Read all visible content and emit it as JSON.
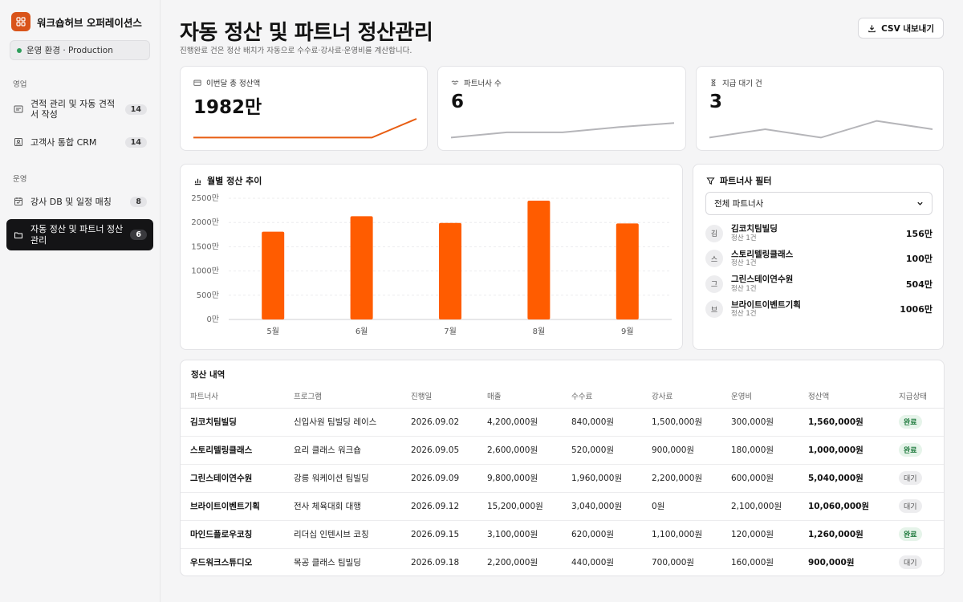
{
  "app": {
    "name": "워크숍허브 오퍼레이션스"
  },
  "env": {
    "label": "운영 환경 · Production"
  },
  "sidebar": {
    "sections": [
      {
        "title": "영업",
        "items": [
          {
            "label": "견적 관리 및 자동 견적서 작성",
            "badge": "14",
            "icon": "quote-icon"
          },
          {
            "label": "고객사 통합 CRM",
            "badge": "14",
            "icon": "contacts-icon"
          }
        ]
      },
      {
        "title": "운영",
        "items": [
          {
            "label": "강사 DB 및 일정 매칭",
            "badge": "8",
            "icon": "calendar-icon"
          },
          {
            "label": "자동 정산 및 파트너 정산관리",
            "badge": "6",
            "icon": "folder-icon",
            "active": true
          }
        ]
      }
    ]
  },
  "header": {
    "title": "자동 정산 및 파트너 정산관리",
    "subtitle": "진행완료 건은 정산 배치가 자동으로 수수료·강사료·운영비를 계산합니다.",
    "csv_label": "CSV 내보내기"
  },
  "kpis": [
    {
      "label": "이번달 총 정산액",
      "value": "1982만",
      "icon": "wallet-icon",
      "spark": [
        0.1,
        0.1,
        0.1,
        0.1,
        0.1,
        1.0
      ],
      "color": "#e85d12"
    },
    {
      "label": "파트너사 수",
      "value": "6",
      "icon": "handshake-icon",
      "spark": [
        0.1,
        0.35,
        0.35,
        0.6,
        0.8
      ],
      "color": "#b5b5b9"
    },
    {
      "label": "지급 대기 건",
      "value": "3",
      "icon": "hourglass-icon",
      "spark": [
        0.1,
        0.5,
        0.1,
        0.9,
        0.5
      ],
      "color": "#b5b5b9"
    }
  ],
  "chart_data": {
    "title": "월별 정산 추이",
    "type": "bar",
    "categories": [
      "5월",
      "6월",
      "7월",
      "8월",
      "9월"
    ],
    "values": [
      1810,
      2130,
      1990,
      2450,
      1980
    ],
    "ylim": [
      0,
      2500
    ],
    "yticks": [
      0,
      500,
      1000,
      1500,
      2000,
      2500
    ],
    "ytick_labels": [
      "0만",
      "500만",
      "1000만",
      "1500만",
      "2000만",
      "2500만"
    ],
    "grid": true,
    "color": "#ff5c00"
  },
  "filter": {
    "title": "파트너사 필터",
    "selected": "전체 파트너사",
    "partners": [
      {
        "initial": "김",
        "name": "김코치팀빌딩",
        "meta": "정산 1건",
        "amount": "156만"
      },
      {
        "initial": "스",
        "name": "스토리텔링클래스",
        "meta": "정산 1건",
        "amount": "100만"
      },
      {
        "initial": "그",
        "name": "그린스테이연수원",
        "meta": "정산 1건",
        "amount": "504만"
      },
      {
        "initial": "브",
        "name": "브라이트이벤트기획",
        "meta": "정산 1건",
        "amount": "1006만"
      }
    ]
  },
  "table": {
    "title": "정산 내역",
    "columns": [
      "파트너사",
      "프로그램",
      "진행일",
      "매출",
      "수수료",
      "강사료",
      "운영비",
      "정산액",
      "지급상태"
    ],
    "rows": [
      [
        "김코치팀빌딩",
        "신입사원 팀빌딩 레이스",
        "2026.09.02",
        "4,200,000원",
        "840,000원",
        "1,500,000원",
        "300,000원",
        "1,560,000원",
        "완료"
      ],
      [
        "스토리텔링클래스",
        "요리 클래스 워크숍",
        "2026.09.05",
        "2,600,000원",
        "520,000원",
        "900,000원",
        "180,000원",
        "1,000,000원",
        "완료"
      ],
      [
        "그린스테이연수원",
        "강릉 워케이션 팀빌딩",
        "2026.09.09",
        "9,800,000원",
        "1,960,000원",
        "2,200,000원",
        "600,000원",
        "5,040,000원",
        "대기"
      ],
      [
        "브라이트이벤트기획",
        "전사 체육대회 대행",
        "2026.09.12",
        "15,200,000원",
        "3,040,000원",
        "0원",
        "2,100,000원",
        "10,060,000원",
        "대기"
      ],
      [
        "마인드플로우코칭",
        "리더십 인텐시브 코칭",
        "2026.09.15",
        "3,100,000원",
        "620,000원",
        "1,100,000원",
        "120,000원",
        "1,260,000원",
        "완료"
      ],
      [
        "우드워크스튜디오",
        "목공 클래스 팀빌딩",
        "2026.09.18",
        "2,200,000원",
        "440,000원",
        "700,000원",
        "160,000원",
        "900,000원",
        "대기"
      ]
    ],
    "status_done": "완료"
  }
}
